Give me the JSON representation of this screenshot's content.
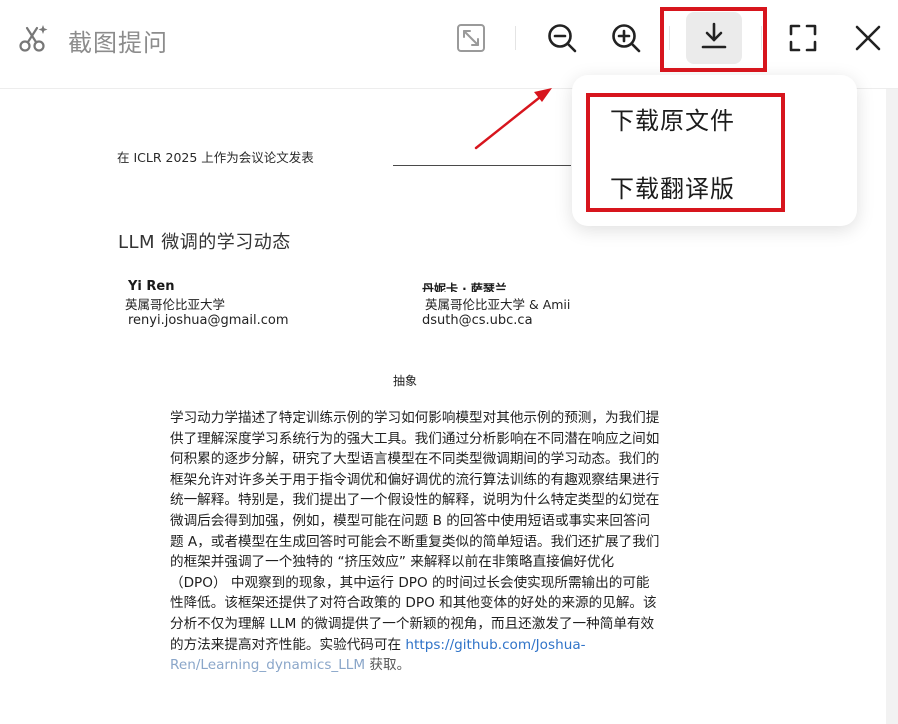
{
  "app": {
    "title": "截图提问"
  },
  "toolbar": {
    "buttons": [
      {
        "name": "fit-screen-button",
        "icon": "fit-screen-icon"
      },
      {
        "name": "zoom-out-button",
        "icon": "zoom-out-icon"
      },
      {
        "name": "zoom-in-button",
        "icon": "zoom-in-icon"
      },
      {
        "name": "download-button",
        "icon": "download-icon"
      },
      {
        "name": "fullscreen-button",
        "icon": "expand-icon"
      },
      {
        "name": "close-button",
        "icon": "close-icon"
      }
    ]
  },
  "download_menu": {
    "items": [
      {
        "label": "下载原文件"
      },
      {
        "label": "下载翻译版"
      }
    ]
  },
  "document": {
    "conference": "在 ICLR 2025 上作为会议论文发表",
    "title": "LLM 微调的学习动态",
    "authors": [
      {
        "name": "Yi Ren",
        "affiliation": "英属哥伦比亚大学",
        "email": "renyi.joshua@gmail.com"
      },
      {
        "name": "丹妮卡 · 萨瑟兰",
        "affiliation": "英属哥伦比亚大学 & Amii",
        "email": "dsuth@cs.ubc.ca"
      }
    ],
    "abstract_heading": "抽象",
    "abstract_lines": [
      "学习动力学描述了特定训练示例的学习如何影响模型对其他示例的预测，为我们提",
      "供了理解深度学习系统行为的强大工具。我们通过分析影响在不同潜在响应之间如",
      "何积累的逐步分解，研究了大型语言模型在不同类型微调期间的学习动态。我们的",
      "框架允许对许多关于用于指令调优和偏好调优的流行算法训练的有趣观察结果进行",
      "统一解释。特别是，我们提出了一个假设性的解释，说明为什么特定类型的幻觉在",
      "微调后会得到加强，例如，模型可能在问题 B 的回答中使用短语或事实来回答问",
      "题 A，或者模型在生成回答时可能会不断重复类似的简单短语。我们还扩展了我们",
      "的框架并强调了一个独特的 “挤压效应” 来解释以前在非策略直接偏好优化",
      "（DPO） 中观察到的现象，其中运行 DPO 的时间过长会使实现所需输出的可能",
      "性降低。该框架还提供了对符合政策的 DPO 和其他变体的好处的来源的见解。该",
      "分析不仅为理解 LLM 的微调提供了一个新颖的视角，而且还激发了一种简单有效",
      "的方法来提高对齐性能。实验代码可在 "
    ],
    "code_link_part1": "https://github.com/Joshua-",
    "code_link_part2": "Ren/Learning_dynamics_LLM",
    "code_link_suffix": " 获取。"
  },
  "colors": {
    "highlight_box": "#d7151d",
    "arrow": "#d7151d",
    "link": "#2f73c8",
    "title_gray": "#8c8c8c"
  }
}
